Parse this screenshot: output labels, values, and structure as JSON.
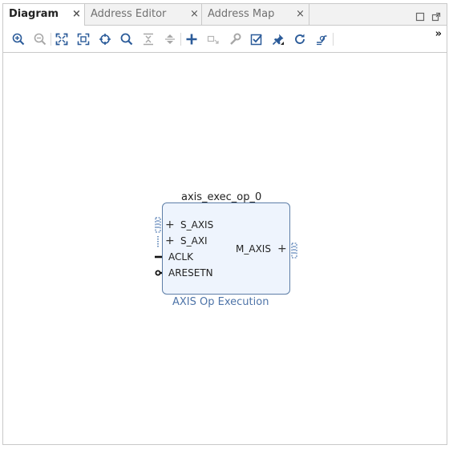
{
  "tabs": [
    {
      "label": "Diagram",
      "active": true
    },
    {
      "label": "Address Editor",
      "active": false
    },
    {
      "label": "Address Map",
      "active": false
    }
  ],
  "tab_close_glyph": "×",
  "window_buttons": [
    "maximize-icon",
    "float-icon"
  ],
  "toolbar": {
    "buttons": [
      "zoom-in-icon",
      "zoom-out-icon",
      "zoom-fit-icon",
      "zoom-selection-icon",
      "auto-connect-icon",
      "search-icon",
      "collapse-all-icon",
      "expand-all-icon",
      "add-ip-icon",
      "make-connection-icon",
      "customize-icon",
      "validate-design-icon",
      "pin-icon",
      "regenerate-layout-icon",
      "optimize-routing-icon"
    ],
    "overflow": "»"
  },
  "block": {
    "instance_name": "axis_exec_op_0",
    "ip_name": "AXIS Op Execution",
    "inputs": [
      "S_AXIS",
      "S_AXI",
      "ACLK",
      "ARESETN"
    ],
    "outputs": [
      "M_AXIS"
    ],
    "fill_color": "#eef4fd",
    "border_color": "#5d7ea7",
    "subtitle_color": "#4e74a8"
  }
}
